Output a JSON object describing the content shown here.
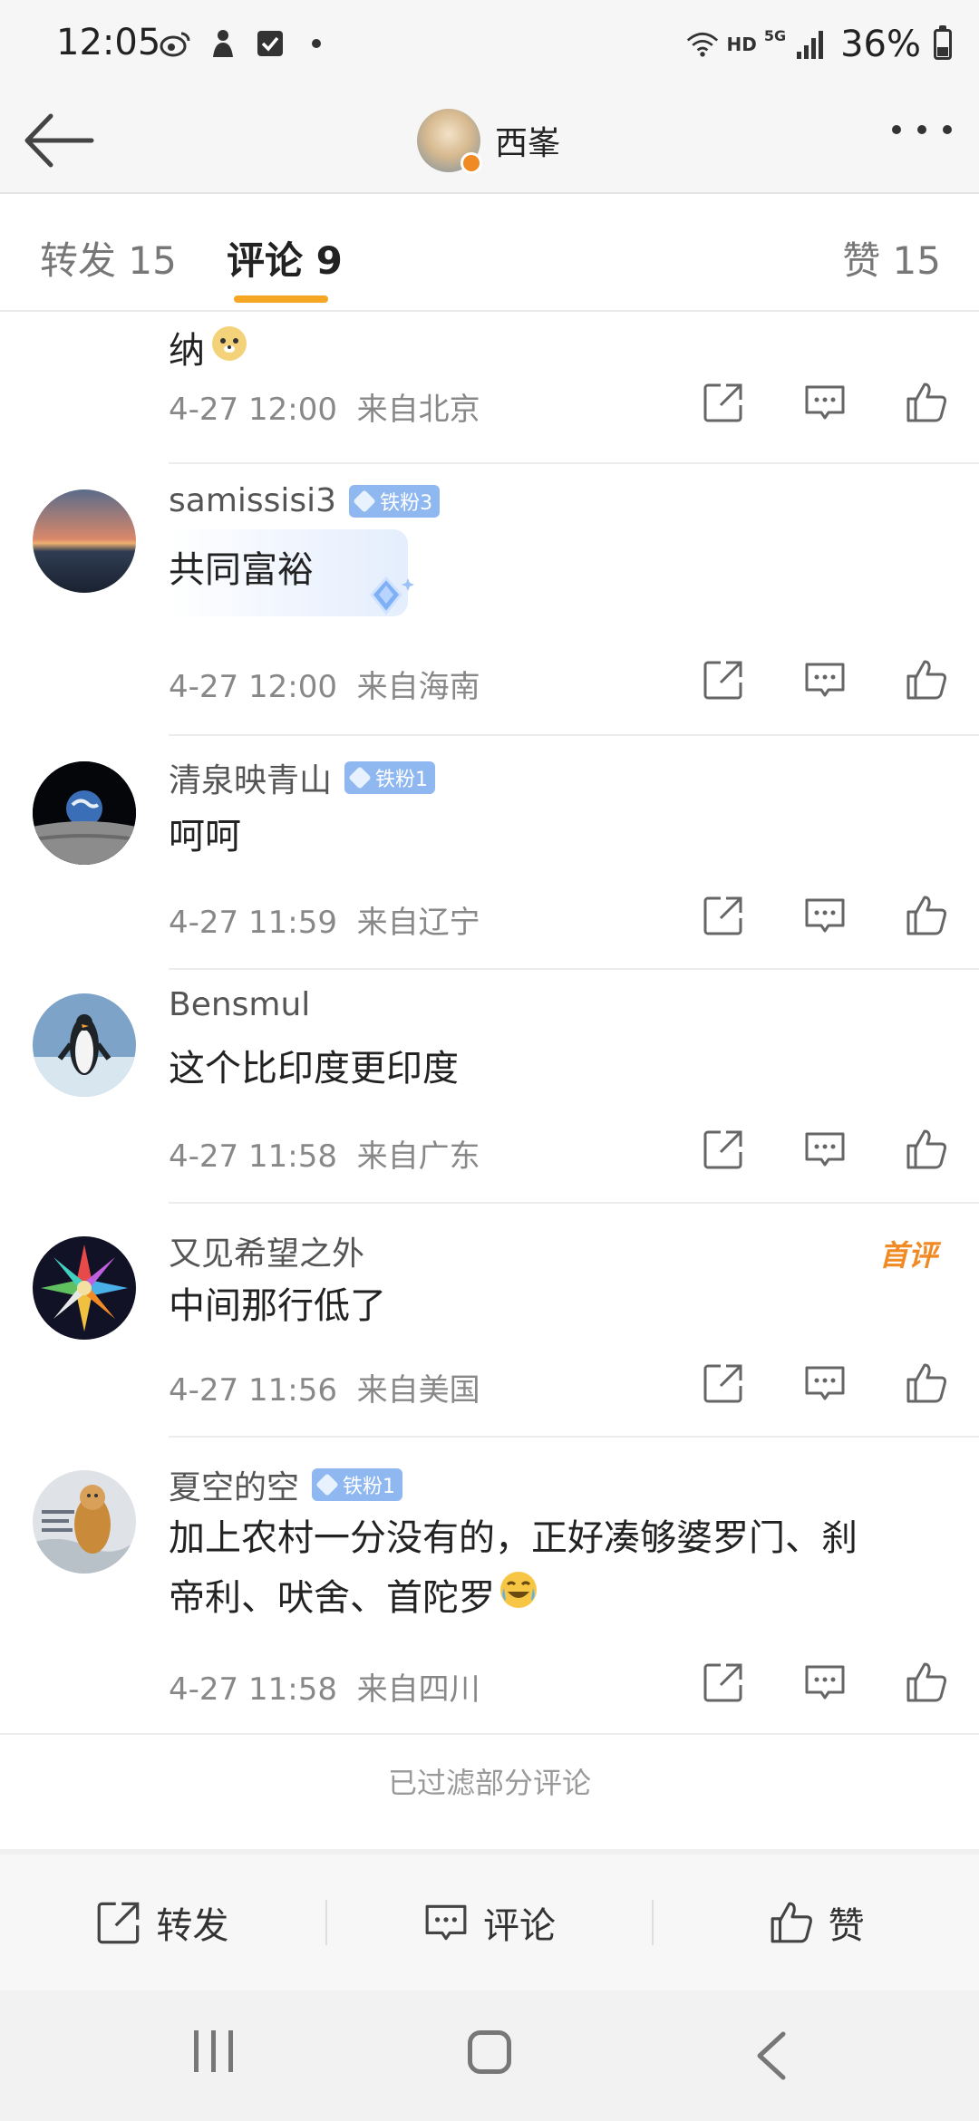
{
  "status_bar": {
    "time": "12:05",
    "left_icons": [
      "weibo-icon",
      "app-icon",
      "checkbox-icon",
      "dot-icon"
    ],
    "hd_label": "HD",
    "network_label": "5G",
    "battery_percent": "36%",
    "battery_level": 0.36
  },
  "nav": {
    "title": "西峯",
    "back_icon": "back-arrow-icon",
    "more_icon": "more-dots-icon"
  },
  "tabs": {
    "repost": "转发 15",
    "comment": "评论 9",
    "like": "赞 15",
    "active": "comment",
    "accent_color": "#f5a623"
  },
  "comments": [
    {
      "name": "",
      "text": "纳",
      "has_emoji": "doge-emoji",
      "date": "4-27 12:00",
      "location": "来自北京"
    },
    {
      "name": "samissisi3",
      "badge": "铁粉3",
      "text": "共同富裕",
      "date": "4-27 12:00",
      "location": "来自海南"
    },
    {
      "name": "清泉映青山",
      "badge": "铁粉1",
      "text": "呵呵",
      "date": "4-27 11:59",
      "location": "来自辽宁"
    },
    {
      "name": "Bensmul",
      "text": "这个比印度更印度",
      "date": "4-27 11:58",
      "location": "来自广东"
    },
    {
      "name": "又见希望之外",
      "tag": "首评",
      "text": "中间那行低了",
      "date": "4-27 11:56",
      "location": "来自美国"
    },
    {
      "name": "夏空的空",
      "badge": "铁粉1",
      "text_line1": "加上农村一分没有的，正好凑够婆罗门、刹",
      "text_line2": "帝利、吠舍、首陀罗",
      "has_emoji": "laugh-cry-emoji",
      "date": "4-27 11:58",
      "location": "来自四川"
    }
  ],
  "filtered_notice": "已过滤部分评论",
  "bottom_bar": {
    "repost": "转发",
    "comment": "评论",
    "like": "赞"
  },
  "system_nav": [
    "recent-apps-icon",
    "home-icon",
    "back-icon"
  ]
}
